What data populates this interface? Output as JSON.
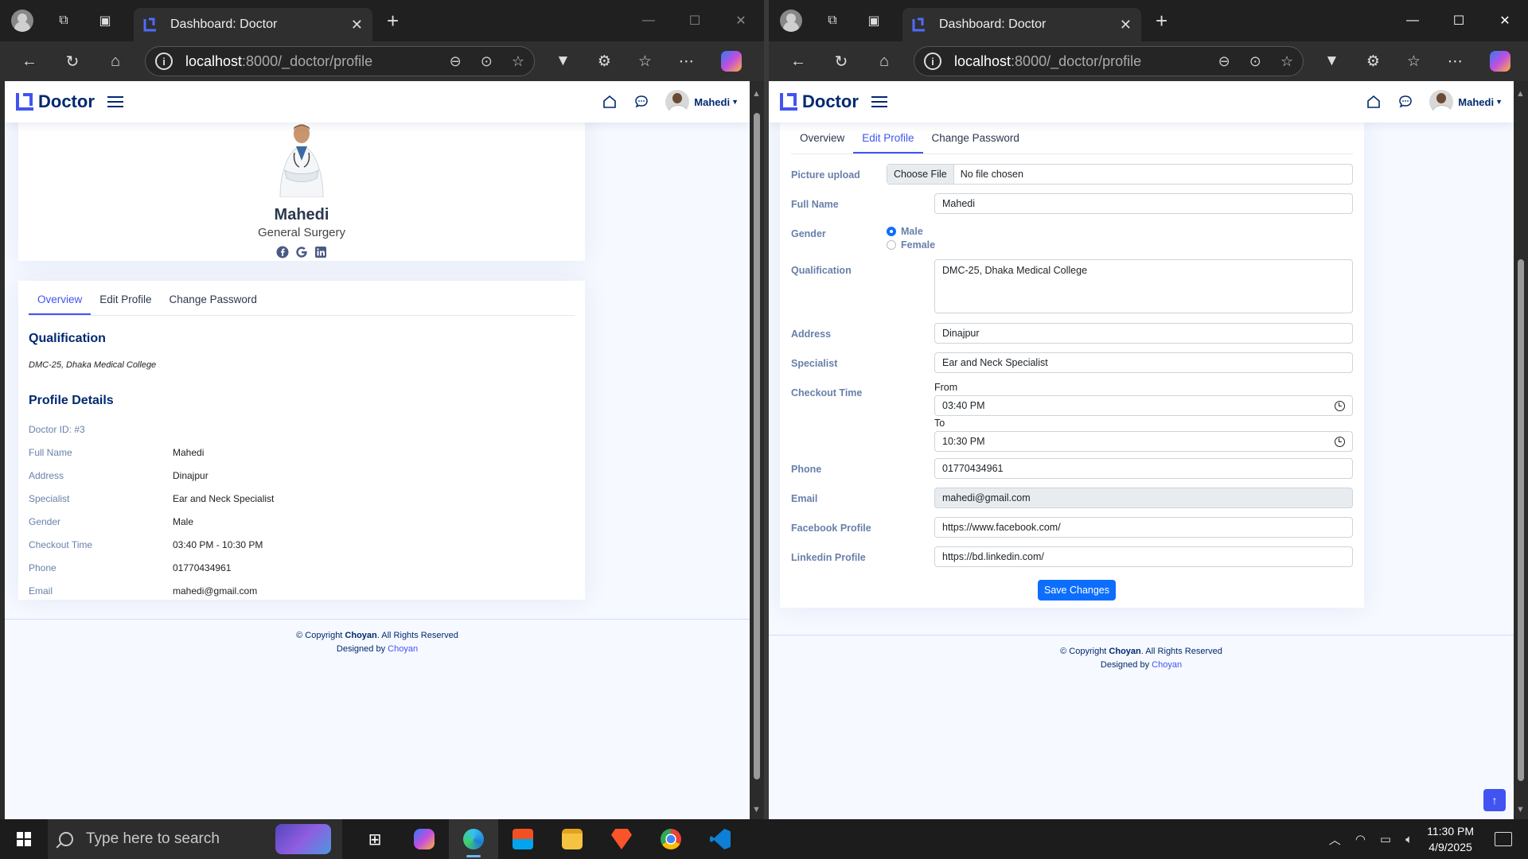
{
  "browser": {
    "tab_title": "Dashboard: Doctor",
    "url_host": "localhost",
    "url_path": ":8000/_doctor/profile"
  },
  "app": {
    "brand": "Doctor",
    "user_name": "Mahedi"
  },
  "profile": {
    "name": "Mahedi",
    "specialty": "General Surgery"
  },
  "tabs": {
    "overview": "Overview",
    "edit_profile": "Edit Profile",
    "change_password": "Change Password"
  },
  "overview": {
    "qualification_title": "Qualification",
    "qualification_text": "DMC-25, Dhaka Medical College",
    "details_title": "Profile Details",
    "doctor_id": "Doctor ID: #3",
    "rows": [
      {
        "label": "Full Name",
        "value": "Mahedi"
      },
      {
        "label": "Address",
        "value": "Dinajpur"
      },
      {
        "label": "Specialist",
        "value": "Ear and Neck Specialist"
      },
      {
        "label": "Gender",
        "value": "Male"
      },
      {
        "label": "Checkout Time",
        "value": "03:40 PM - 10:30 PM"
      },
      {
        "label": "Phone",
        "value": "01770434961"
      },
      {
        "label": "Email",
        "value": "mahedi@gmail.com"
      }
    ]
  },
  "edit_form": {
    "picture_label": "Picture upload",
    "choose_file": "Choose File",
    "no_file": "No file chosen",
    "full_name_label": "Full Name",
    "full_name": "Mahedi",
    "gender_label": "Gender",
    "gender_male": "Male",
    "gender_female": "Female",
    "qualification_label": "Qualification",
    "qualification": "DMC-25, Dhaka Medical College",
    "address_label": "Address",
    "address": "Dinajpur",
    "specialist_label": "Specialist",
    "specialist": "Ear and Neck Specialist",
    "checkout_label": "Checkout Time",
    "from_label": "From",
    "from_time": "03:40  PM",
    "to_label": "To",
    "to_time": "10:30  PM",
    "phone_label": "Phone",
    "phone": "01770434961",
    "email_label": "Email",
    "email": "mahedi@gmail.com",
    "facebook_label": "Facebook Profile",
    "facebook": "https://www.facebook.com/",
    "linkedin_label": "Linkedin Profile",
    "linkedin": "https://bd.linkedin.com/",
    "save": "Save Changes"
  },
  "footer": {
    "copyright_prefix": "© Copyright ",
    "company": "Choyan",
    "rights": ". All Rights Reserved",
    "designed_by": "Designed by ",
    "designer": "Choyan"
  },
  "taskbar": {
    "search_placeholder": "Type here to search",
    "time": "11:30 PM",
    "date": "4/9/2025"
  }
}
